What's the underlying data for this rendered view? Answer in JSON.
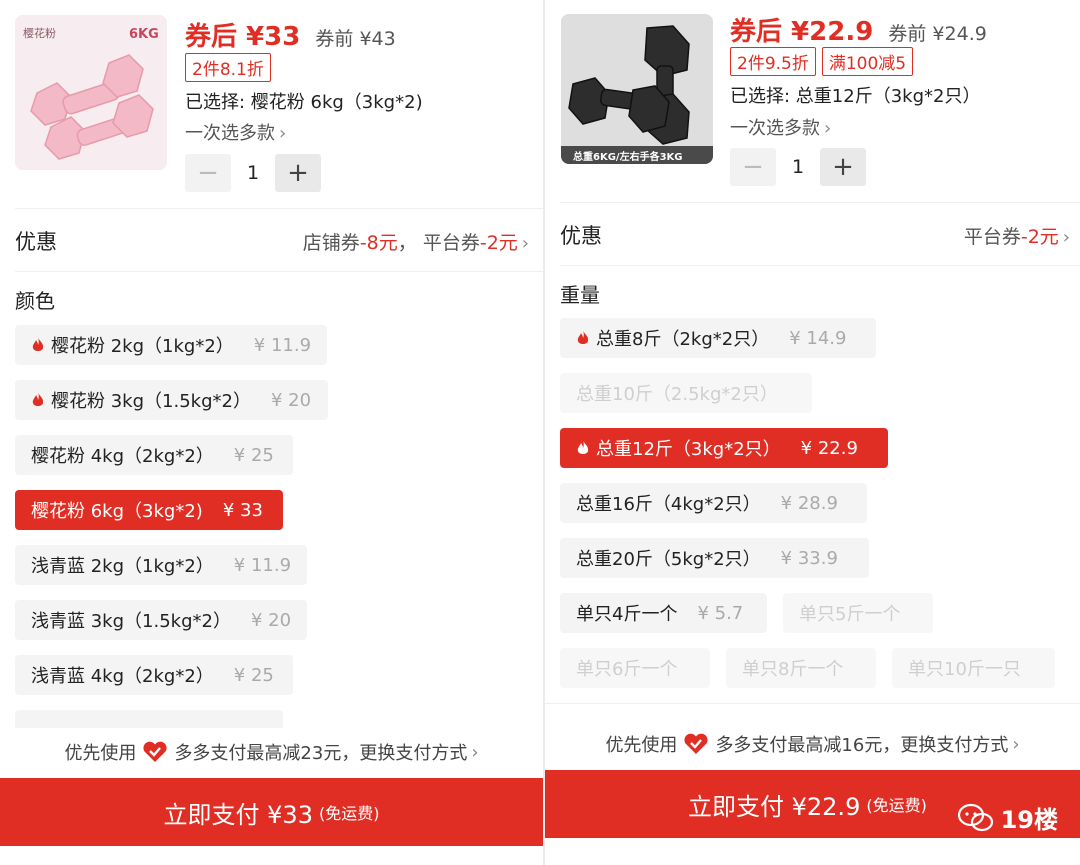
{
  "left": {
    "price_after": "券后 ¥33",
    "price_before": "券前 ¥43",
    "promos": [
      "2件8.1折"
    ],
    "product_image_label": "6KG",
    "product_image_brand": "樱花粉",
    "selected": "已选择: 樱花粉 6kg（3kg*2)",
    "multi_select": "一次选多款",
    "quantity": "1",
    "discount_title": "优惠",
    "discount_store": "店铺券",
    "discount_store_amount": "-8元",
    "discount_sep": "，",
    "discount_platform": "平台券",
    "discount_platform_amount": "-2元",
    "section_title": "颜色",
    "options": [
      {
        "label": "樱花粉 2kg（1kg*2）",
        "price": "¥ 11.9",
        "hot": true,
        "state": "normal"
      },
      {
        "label": "樱花粉 3kg（1.5kg*2）",
        "price": "¥ 20",
        "hot": true,
        "state": "normal"
      },
      {
        "label": "樱花粉 4kg（2kg*2）",
        "price": "¥ 25",
        "hot": false,
        "state": "normal"
      },
      {
        "label": "樱花粉 6kg（3kg*2)",
        "price": "¥ 33",
        "hot": false,
        "state": "active"
      },
      {
        "label": "浅青蓝 2kg（1kg*2）",
        "price": "¥ 11.9",
        "hot": false,
        "state": "normal"
      },
      {
        "label": "浅青蓝 3kg（1.5kg*2）",
        "price": "¥ 20",
        "hot": false,
        "state": "normal"
      },
      {
        "label": "浅青蓝 4kg（2kg*2）",
        "price": "¥ 25",
        "hot": false,
        "state": "normal"
      }
    ],
    "pay_hint_prefix": "优先使用",
    "pay_hint_suffix": "多多支付最高减23元，更换支付方式",
    "pay_button": "立即支付 ¥33",
    "pay_free": "(免运费)"
  },
  "right": {
    "price_after": "券后 ¥22.9",
    "price_before": "券前 ¥24.9",
    "promos": [
      "2件9.5折",
      "满100减5"
    ],
    "product_image_caption": "总重6KG/左右手各3KG",
    "selected": "已选择: 总重12斤（3kg*2只）",
    "multi_select": "一次选多款",
    "quantity": "1",
    "discount_title": "优惠",
    "discount_platform": "平台券",
    "discount_platform_amount": "-2元",
    "section_title": "重量",
    "options": [
      {
        "label": "总重8斤（2kg*2只）",
        "price": "¥ 14.9",
        "hot": true,
        "state": "normal"
      },
      {
        "label": "总重10斤（2.5kg*2只）",
        "price": "",
        "hot": false,
        "state": "disabled"
      },
      {
        "label": "总重12斤（3kg*2只）",
        "price": "¥ 22.9",
        "hot": true,
        "state": "active"
      },
      {
        "label": "总重16斤（4kg*2只）",
        "price": "¥ 28.9",
        "hot": false,
        "state": "normal"
      },
      {
        "label": "总重20斤（5kg*2只）",
        "price": "¥ 33.9",
        "hot": false,
        "state": "normal"
      },
      {
        "label": "单只4斤一个",
        "price": "¥ 5.7",
        "hot": false,
        "state": "normal"
      },
      {
        "label": "单只5斤一个",
        "price": "",
        "hot": false,
        "state": "disabled"
      },
      {
        "label": "单只6斤一个",
        "price": "",
        "hot": false,
        "state": "disabled"
      },
      {
        "label": "单只8斤一个",
        "price": "",
        "hot": false,
        "state": "disabled"
      },
      {
        "label": "单只10斤一只",
        "price": "",
        "hot": false,
        "state": "disabled"
      }
    ],
    "pay_hint_prefix": "优先使用",
    "pay_hint_suffix": "多多支付最高减16元，更换支付方式",
    "pay_button": "立即支付 ¥22.9",
    "pay_free": "(免运费)"
  },
  "watermark": "19楼",
  "colors": {
    "accent": "#e02e24",
    "chip_bg": "#f4f4f4",
    "disabled_text": "#cfcfcf"
  },
  "icons": {
    "hot": "fire-icon",
    "heart": "heart-icon",
    "chevron": "chevron-right-icon",
    "minus": "minus-icon",
    "plus": "plus-icon",
    "watermark": "wechat-icon"
  }
}
